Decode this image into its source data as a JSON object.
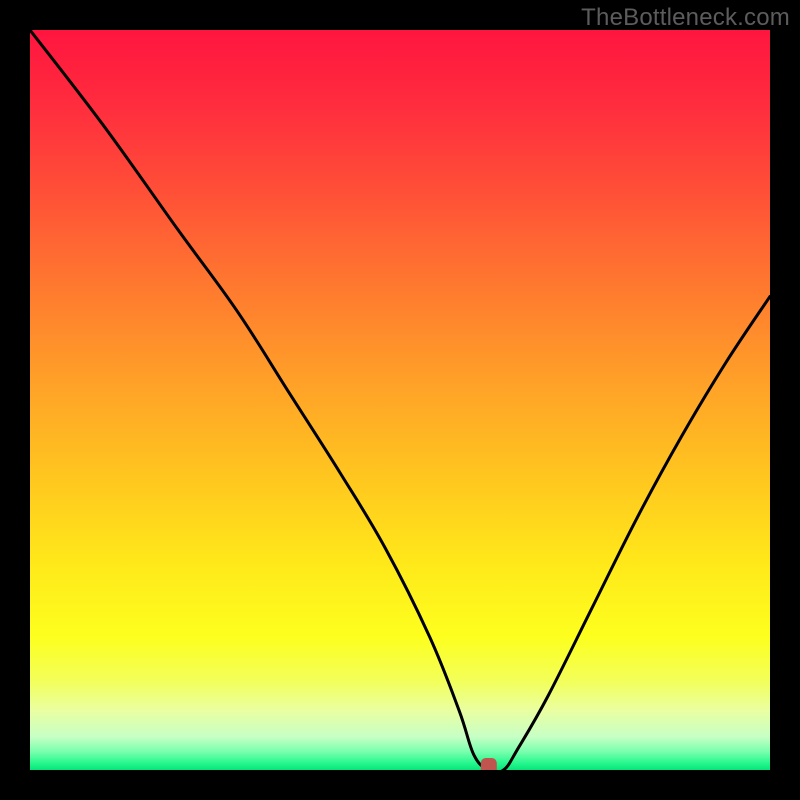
{
  "watermark": "TheBottleneck.com",
  "chart_data": {
    "type": "line",
    "title": "",
    "xlabel": "",
    "ylabel": "",
    "xlim": [
      0,
      100
    ],
    "ylim": [
      0,
      100
    ],
    "grid": false,
    "legend": false,
    "series": [
      {
        "name": "bottleneck-curve",
        "x": [
          0,
          10,
          20,
          28,
          35,
          42,
          48,
          54,
          58,
          60,
          62,
          64,
          66,
          70,
          76,
          82,
          88,
          94,
          100
        ],
        "values": [
          100,
          87,
          73,
          62,
          51,
          40,
          30,
          18,
          8,
          2,
          0,
          0,
          3,
          10,
          22,
          34,
          45,
          55,
          64
        ]
      }
    ],
    "marker": {
      "x": 62,
      "y": 0,
      "color": "#c0554f",
      "shape": "rounded-rect"
    },
    "gradient_stops": [
      {
        "offset": 0.0,
        "color": "#ff153f"
      },
      {
        "offset": 0.1,
        "color": "#ff2c3e"
      },
      {
        "offset": 0.22,
        "color": "#ff5037"
      },
      {
        "offset": 0.35,
        "color": "#ff7a2f"
      },
      {
        "offset": 0.48,
        "color": "#ffa228"
      },
      {
        "offset": 0.6,
        "color": "#ffc51f"
      },
      {
        "offset": 0.72,
        "color": "#ffe81a"
      },
      {
        "offset": 0.82,
        "color": "#fdff1e"
      },
      {
        "offset": 0.88,
        "color": "#f3ff5a"
      },
      {
        "offset": 0.92,
        "color": "#e9ffa2"
      },
      {
        "offset": 0.955,
        "color": "#c7ffc5"
      },
      {
        "offset": 0.975,
        "color": "#7affae"
      },
      {
        "offset": 0.99,
        "color": "#29f88f"
      },
      {
        "offset": 1.0,
        "color": "#06e579"
      }
    ]
  }
}
